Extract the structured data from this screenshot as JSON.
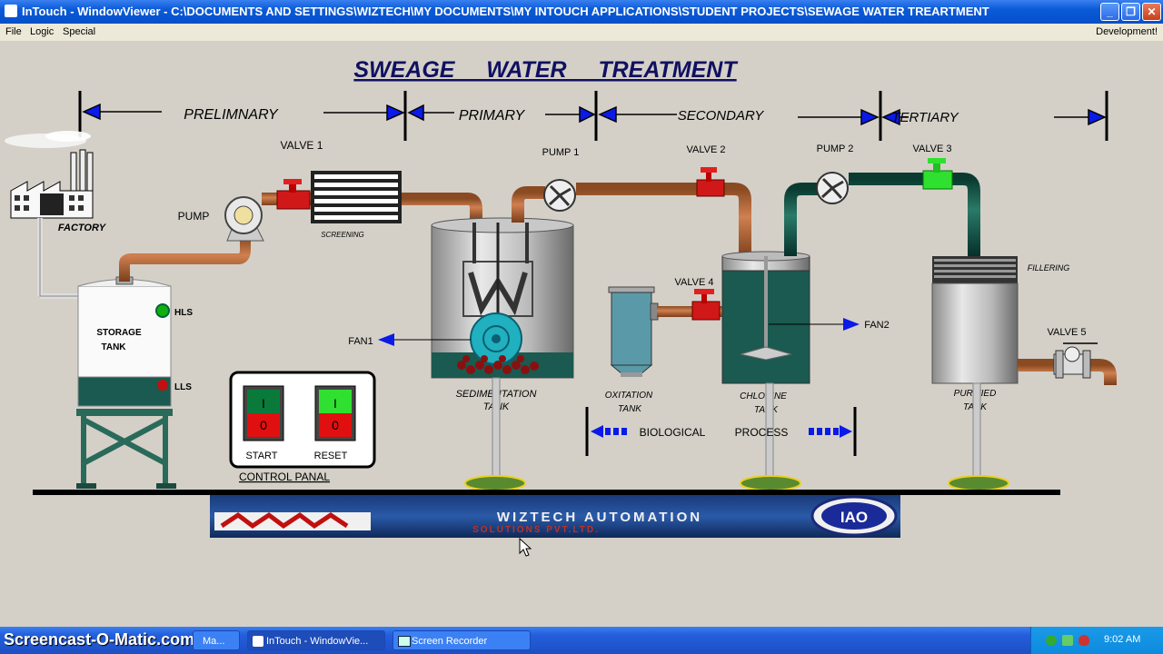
{
  "window": {
    "title": "InTouch - WindowViewer - C:\\DOCUMENTS AND SETTINGS\\WIZTECH\\MY DOCUMENTS\\MY INTOUCH APPLICATIONS\\STUDENT PROJECTS\\SEWAGE WATER TREARTMENT",
    "minimize": "_",
    "maximize": "❐",
    "close": "✕"
  },
  "menu": {
    "file": "File",
    "logic": "Logic",
    "special": "Special",
    "development": "Development!"
  },
  "diagram": {
    "title": "SWEAGE     WATER     TREATMENT",
    "stages": {
      "preliminary": "PRELIMNARY",
      "primary": "PRIMARY",
      "secondary": "SECONDARY",
      "tertiary": "TERTIARY"
    },
    "labels": {
      "factory": "FACTORY",
      "pump": "PUMP",
      "valve1": "VALVE 1",
      "screening": "SCREENING",
      "pump1": "PUMP 1",
      "valve2": "VALVE 2",
      "pump2": "PUMP 2",
      "valve3": "VALVE 3",
      "valve4": "VALVE 4",
      "valve5": "VALVE 5",
      "fillering": "FILLERING",
      "storage_tank_1": "STORAGE",
      "storage_tank_2": "TANK",
      "hls": "HLS",
      "lls": "LLS",
      "fan1": "FAN1",
      "fan2": "FAN2",
      "sedimentation_1": "SEDIMENTATION",
      "sedimentation_2": "TANK",
      "oxitation_1": "OXITATION",
      "oxitation_2": "TANK",
      "chlorine_1": "CHLORINE",
      "chlorine_2": "TANK",
      "purified_1": "PURIFIED",
      "purified_2": "TANK",
      "biological": "BIOLOGICAL",
      "process": "PROCESS"
    },
    "control_panel": {
      "label": "CONTROL PANAL",
      "start": "START",
      "reset": "RESET",
      "on_glyph": "I",
      "off_glyph": "0"
    },
    "banner": {
      "brand": "WIZTECH AUTOMATION",
      "sub": "SOLUTIONS PVT.LTD.",
      "badge": "IAO"
    },
    "colors": {
      "pipe": "#b4683a",
      "green_pipe": "#0a5a48",
      "water": "#1a5a50",
      "valve_red": "#e01818",
      "valve_green": "#30e030",
      "arrow_blue": "#0a1ae8"
    }
  },
  "taskbar": {
    "watermark": "Screencast-O-Matic.com",
    "item1": "Ma...",
    "item2": "InTouch - WindowVie...",
    "item3": "Screen Recorder",
    "time": "9:02 AM"
  }
}
